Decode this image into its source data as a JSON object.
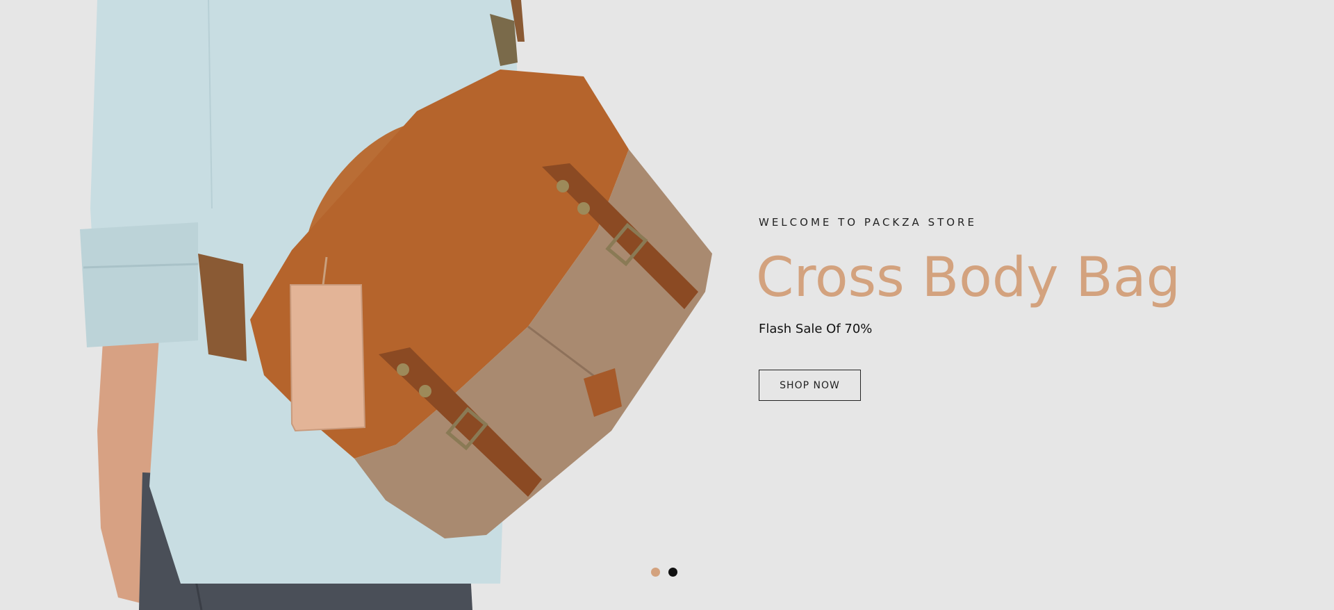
{
  "slider": {
    "eyebrow": "WELCOME TO PACKZA STORE",
    "title": "Cross Body Bag",
    "subtitle": "Flash Sale Of 70%",
    "cta_label": "SHOP NOW",
    "image_icon": "man-with-leather-messenger-bag-photo",
    "active_slide": 1,
    "slide_count": 2
  },
  "colors": {
    "background": "#e6e6e6",
    "accent": "#d3a27e",
    "text": "#111111",
    "dot_active": "#d3a27e",
    "dot_inactive": "#111111"
  }
}
